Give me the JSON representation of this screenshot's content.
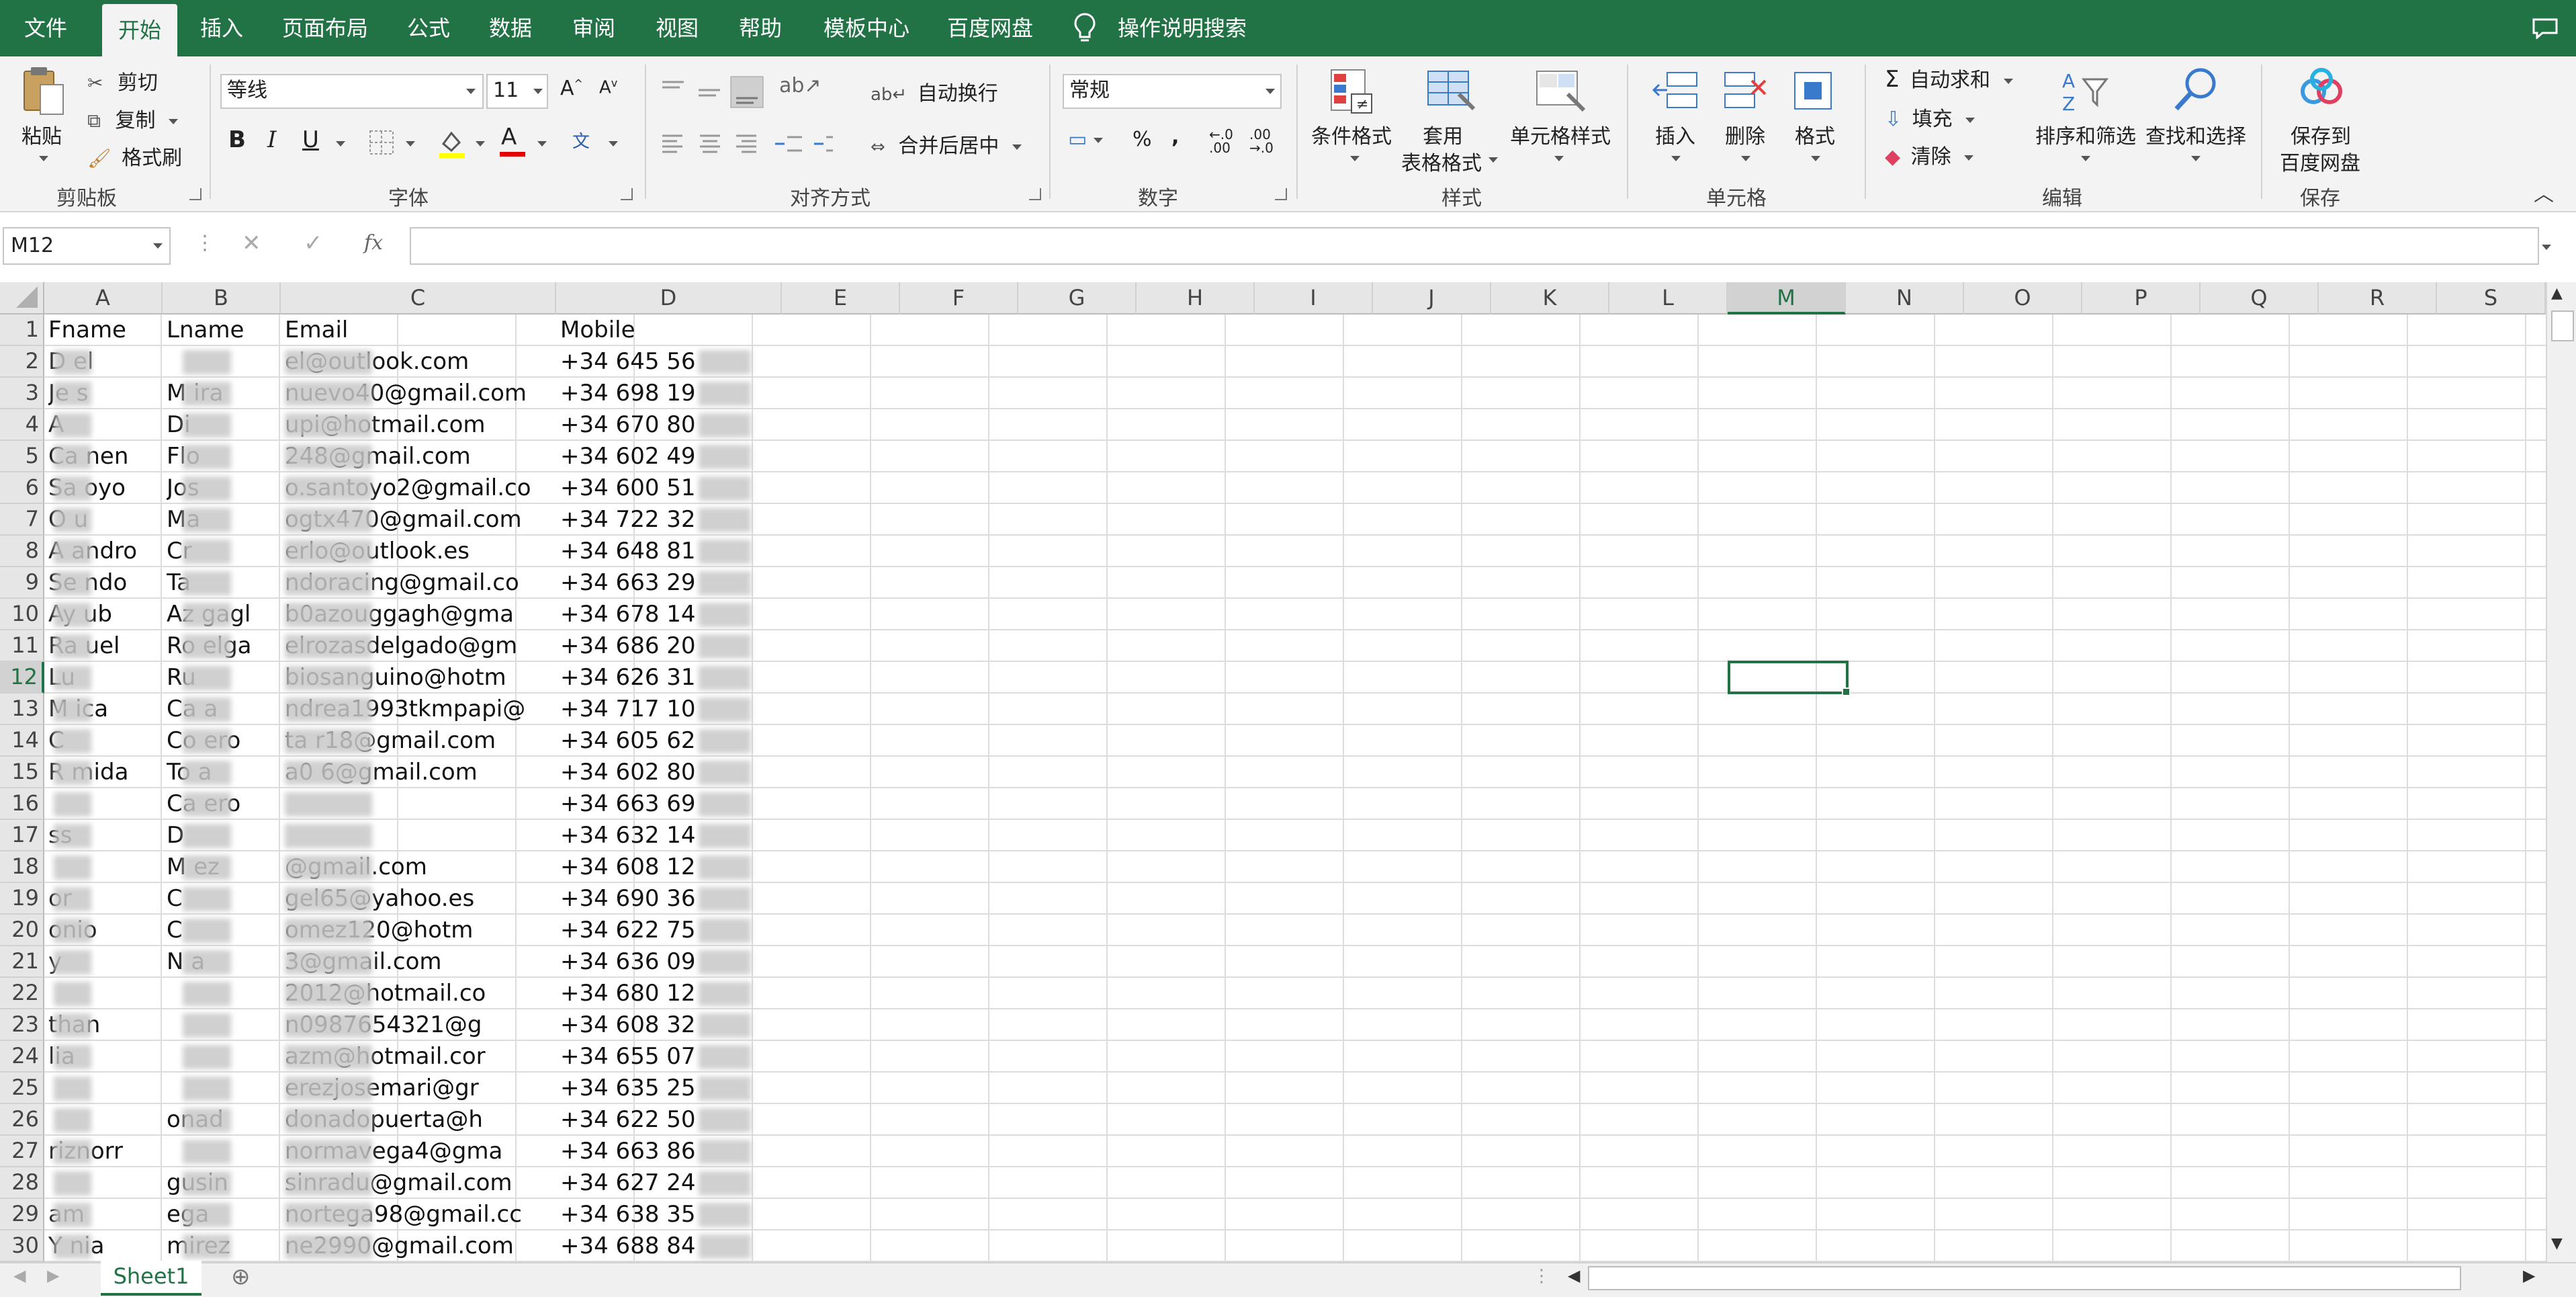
{
  "menubar": {
    "tabs": [
      "文件",
      "开始",
      "插入",
      "页面布局",
      "公式",
      "数据",
      "审阅",
      "视图",
      "帮助",
      "模板中心",
      "百度网盘"
    ],
    "active": "开始",
    "search": "操作说明搜索"
  },
  "ribbon": {
    "clipboard": {
      "paste": "粘贴",
      "cut": "剪切",
      "copy": "复制",
      "format_painter": "格式刷",
      "label": "剪贴板"
    },
    "font": {
      "family": "等线",
      "size": "11",
      "label": "字体"
    },
    "alignment": {
      "wrap": "自动换行",
      "merge": "合并后居中",
      "label": "对齐方式"
    },
    "number": {
      "format": "常规",
      "label": "数字"
    },
    "styles": {
      "conditional": "条件格式",
      "table1": "套用",
      "table2": "表格格式",
      "cell_styles": "单元格样式",
      "label": "样式"
    },
    "cells": {
      "insert": "插入",
      "delete": "删除",
      "format": "格式",
      "label": "单元格"
    },
    "editing": {
      "autosum": "自动求和",
      "fill": "填充",
      "clear": "清除",
      "sort": "排序和筛选",
      "find": "查找和选择",
      "label": "编辑"
    },
    "save": {
      "line1": "保存到",
      "line2": "百度网盘",
      "label": "保存"
    }
  },
  "formula": {
    "namebox": "M12",
    "value": ""
  },
  "columns": [
    "A",
    "B",
    "C",
    "D",
    "E",
    "F",
    "G",
    "H",
    "I",
    "J",
    "K",
    "L",
    "M",
    "N",
    "O",
    "P",
    "Q",
    "R",
    "S"
  ],
  "selected_col": "M",
  "selected_row": "12",
  "rows": [
    {
      "n": "1",
      "a": "Fname",
      "b": "Lname",
      "c": "Email",
      "d": "Mobile"
    },
    {
      "n": "2",
      "a": "D    el",
      "b": "",
      "c": "        el@outlook.com",
      "d": "+34 645 56"
    },
    {
      "n": "3",
      "a": "Je   s",
      "b": "M     ira",
      "c": "        nuevo40@gmail.com",
      "d": "+34 698 19"
    },
    {
      "n": "4",
      "a": "A",
      "b": "Di",
      "c": "        upi@hotmail.com",
      "d": "+34 670 80"
    },
    {
      "n": "5",
      "a": "Ca   nen",
      "b": "Flo",
      "c": "        248@gmail.com",
      "d": "+34 602 49"
    },
    {
      "n": "6",
      "a": "Sa   oyo",
      "b": "Jos",
      "c": "        o.santoyo2@gmail.co",
      "d": "+34 600 51"
    },
    {
      "n": "7",
      "a": "O   u",
      "b": "Ma",
      "c": "        ogtx470@gmail.com",
      "d": "+34 722 32"
    },
    {
      "n": "8",
      "a": "A   andro",
      "b": "Cr",
      "c": "        erlo@outlook.es",
      "d": "+34 648 81"
    },
    {
      "n": "9",
      "a": "Se   ndo",
      "b": "Ta",
      "c": "        ndoracing@gmail.co",
      "d": "+34 663 29"
    },
    {
      "n": "10",
      "a": "Ay   ub",
      "b": "Az    gagl",
      "c": "        b0azouggagh@gma",
      "d": "+34 678 14"
    },
    {
      "n": "11",
      "a": "Ra   uel",
      "b": "Ro    elga",
      "c": "        elrozasdelgado@gm",
      "d": "+34 686 20"
    },
    {
      "n": "12",
      "a": "Lu",
      "b": "Ru",
      "c": "        biosanguino@hotm",
      "d": "+34 626 31"
    },
    {
      "n": "13",
      "a": "M   ica",
      "b": "Ca    a",
      "c": "        ndrea1993tkmpapi@",
      "d": "+34 717 10"
    },
    {
      "n": "14",
      "a": "C",
      "b": "Co    ero",
      "c": "        ta    r18@gmail.com",
      "d": "+34 605 62"
    },
    {
      "n": "15",
      "a": "R   mida",
      "b": "To    a",
      "c": "        a0    6@gmail.com",
      "d": "+34 602 80"
    },
    {
      "n": "16",
      "a": "",
      "b": "Ca    ero",
      "c": "",
      "d": "+34 663 69"
    },
    {
      "n": "17",
      "a": "    ss",
      "b": "D",
      "c": "",
      "d": "+34 632 14"
    },
    {
      "n": "18",
      "a": "",
      "b": "M    ez",
      "c": "        @gmail.com",
      "d": "+34 608 12"
    },
    {
      "n": "19",
      "a": "    or",
      "b": "C",
      "c": "        gel65@yahoo.es",
      "d": "+34 690 36"
    },
    {
      "n": "20",
      "a": "    onio",
      "b": "C",
      "c": "        omez120@hotm",
      "d": "+34 622 75"
    },
    {
      "n": "21",
      "a": "    y",
      "b": "N     a",
      "c": "        3@gmail.com",
      "d": "+34 636 09"
    },
    {
      "n": "22",
      "a": "",
      "b": "",
      "c": "        2012@hotmail.co",
      "d": "+34 680 12"
    },
    {
      "n": "23",
      "a": "    than",
      "b": "",
      "c": "        n0987654321@g",
      "d": "+34 608 32"
    },
    {
      "n": "24",
      "a": "    lia",
      "b": "",
      "c": "        azm@hotmail.cor",
      "d": "+34 655 07"
    },
    {
      "n": "25",
      "a": "",
      "b": "",
      "c": "        erezjosemari@gr",
      "d": "+34 635 25"
    },
    {
      "n": "26",
      "a": "",
      "b": "    onad",
      "c": "        donadopuerta@h",
      "d": "+34 622 50"
    },
    {
      "n": "27",
      "a": "    riznorr",
      "b": "",
      "c": "        normavega4@gma",
      "d": "+34 663 86"
    },
    {
      "n": "28",
      "a": "",
      "b": "    gusin",
      "c": "        sinradu@gmail.com",
      "d": "+34 627 24"
    },
    {
      "n": "29",
      "a": "    am",
      "b": "    ega",
      "c": "        nortega98@gmail.cc",
      "d": "+34 638 35"
    },
    {
      "n": "30",
      "a": "Y    nia",
      "b": "    mirez",
      "c": "        ne2990@gmail.com",
      "d": "+34 688 84"
    }
  ],
  "sheet": {
    "name": "Sheet1"
  },
  "colors": {
    "accent": "#217346",
    "ribbon_bg": "#f3f3f3",
    "grid": "#dcdcdc"
  }
}
